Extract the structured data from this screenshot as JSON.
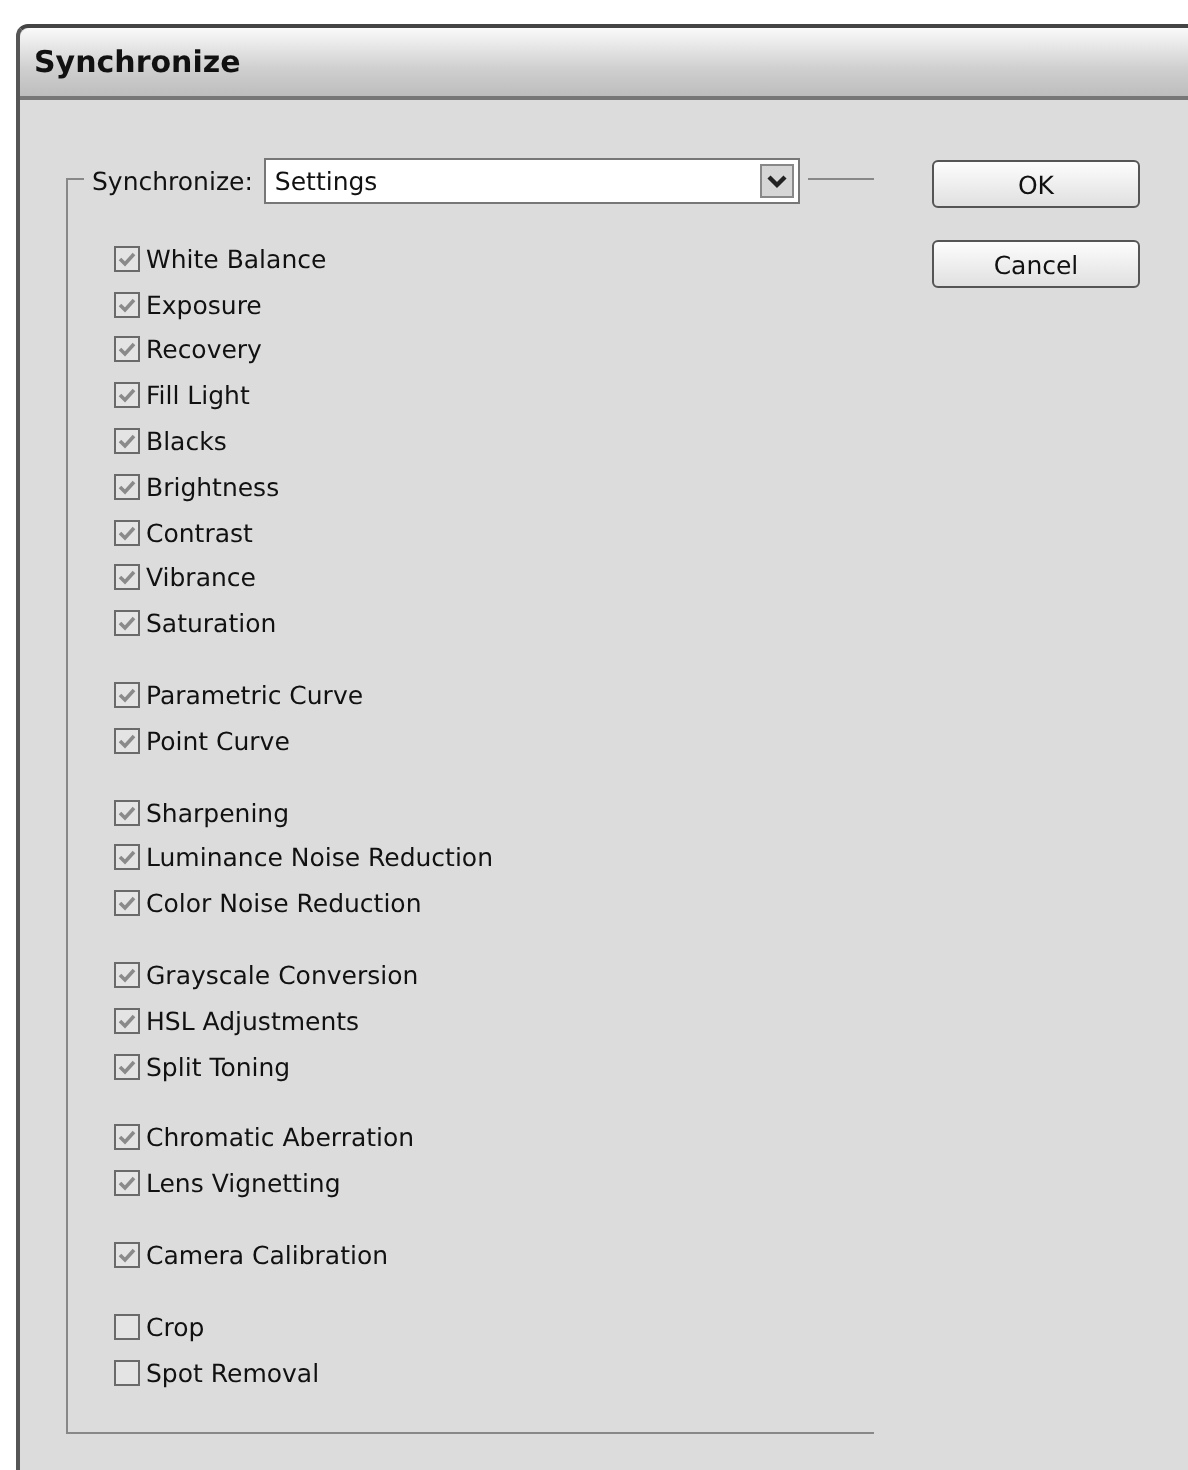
{
  "window": {
    "title": "Synchronize"
  },
  "synchronize": {
    "label": "Synchronize:",
    "value": "Settings"
  },
  "groups": [
    {
      "items": [
        {
          "label": "White Balance",
          "checked": true
        },
        {
          "label": "Exposure",
          "checked": true
        },
        {
          "label": "Recovery",
          "checked": true
        },
        {
          "label": "Fill Light",
          "checked": true
        },
        {
          "label": "Blacks",
          "checked": true
        },
        {
          "label": "Brightness",
          "checked": true
        },
        {
          "label": "Contrast",
          "checked": true
        },
        {
          "label": "Vibrance",
          "checked": true
        },
        {
          "label": "Saturation",
          "checked": true
        }
      ]
    },
    {
      "items": [
        {
          "label": "Parametric Curve",
          "checked": true
        },
        {
          "label": "Point Curve",
          "checked": true
        }
      ]
    },
    {
      "items": [
        {
          "label": "Sharpening",
          "checked": true
        },
        {
          "label": "Luminance Noise Reduction",
          "checked": true
        },
        {
          "label": "Color Noise Reduction",
          "checked": true
        }
      ]
    },
    {
      "items": [
        {
          "label": "Grayscale Conversion",
          "checked": true
        },
        {
          "label": "HSL Adjustments",
          "checked": true
        },
        {
          "label": "Split Toning",
          "checked": true
        }
      ]
    },
    {
      "items": [
        {
          "label": "Chromatic Aberration",
          "checked": true
        },
        {
          "label": "Lens Vignetting",
          "checked": true
        }
      ]
    },
    {
      "items": [
        {
          "label": "Camera Calibration",
          "checked": true
        }
      ]
    },
    {
      "items": [
        {
          "label": "Crop",
          "checked": false
        },
        {
          "label": "Spot Removal",
          "checked": false
        }
      ]
    }
  ],
  "buttons": [
    "OK",
    "Cancel"
  ]
}
